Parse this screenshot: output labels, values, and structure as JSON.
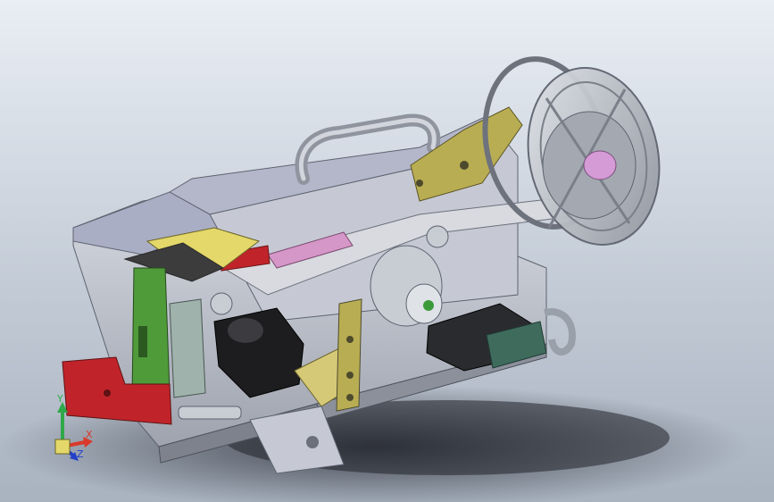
{
  "viewport": {
    "background_top": "#e9eef4",
    "background_bottom": "#a9b3c0"
  },
  "triad": {
    "x_label": "X",
    "y_label": "Y",
    "z_label": "Z",
    "x_color": "#d93a2b",
    "y_color": "#2fa84a",
    "z_color": "#2340c8"
  },
  "model": {
    "base_color": "#c9ccd6",
    "panel_color": "#a9aec4",
    "green_part_color": "#4f9b3a",
    "red_part_color": "#c0242a",
    "yellow_part_color": "#e4d86a",
    "olive_part_color": "#b9ad53",
    "pink_part_color": "#d597c7",
    "motor_color": "#1d1d1f",
    "dark_green_part_color": "#3f6b5d",
    "reel_color": "#bfc4cc",
    "hub_color": "#d59bd6"
  }
}
